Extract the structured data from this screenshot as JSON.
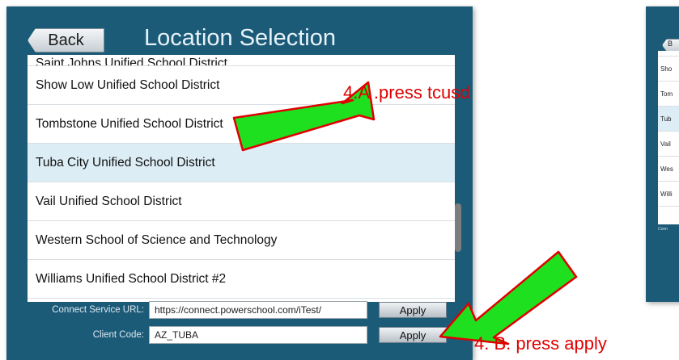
{
  "panel": {
    "back_label": "Back",
    "title": "Location Selection",
    "list": [
      {
        "label": "Saint Johns Unified School District",
        "partial": true
      },
      {
        "label": "Show Low Unified School District"
      },
      {
        "label": "Tombstone Unified School District"
      },
      {
        "label": "Tuba City Unified School District",
        "selected": true
      },
      {
        "label": "Vail Unified School District"
      },
      {
        "label": "Western School of Science and Technology"
      },
      {
        "label": "Williams Unified School District #2",
        "partial": true
      }
    ],
    "connect_url_label": "Connect Service URL:",
    "connect_url_value": "https://connect.powerschool.com/iTest/",
    "client_code_label": "Client Code:",
    "client_code_value": "AZ_TUBA",
    "apply_label": "Apply"
  },
  "panel2": {
    "back_label": "B",
    "list": [
      "Sho",
      "Tom",
      "Tub",
      "Vail",
      "Wes",
      "Willi"
    ],
    "connect_label": "Conn"
  },
  "annotations": {
    "a": "4.A .press tcusd",
    "b": "4. B. press apply"
  },
  "colors": {
    "panel_bg": "#1c5b78",
    "selected_row": "#dcedf5",
    "arrow_fill": "#1fe01f",
    "arrow_stroke": "#e00000",
    "annotation_text": "#e00000"
  }
}
